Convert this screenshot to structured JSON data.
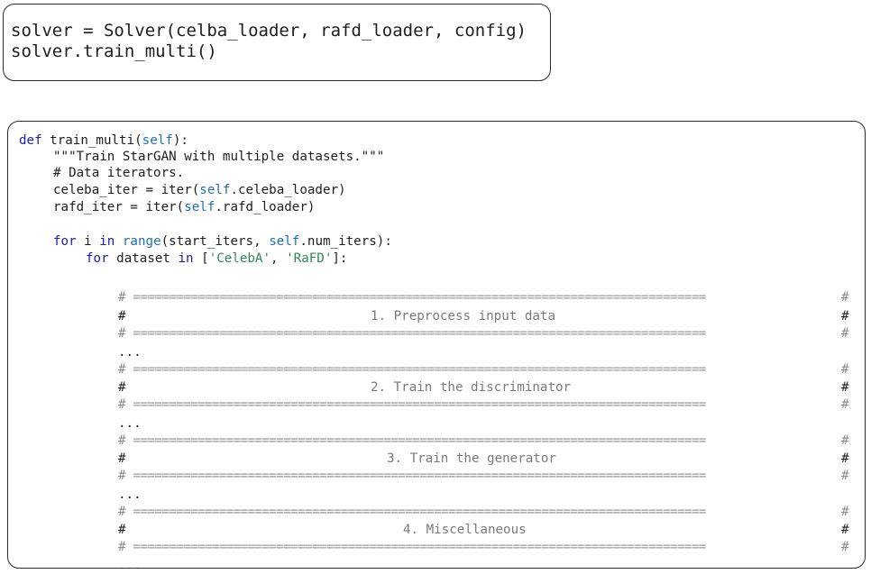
{
  "snippet_top": {
    "line1": "solver = Solver(celba_loader, rafd_loader, config)",
    "line2": "solver.train_multi()"
  },
  "snippet_main": {
    "kw_def": "def",
    "func_name": " train_multi(",
    "self_kw": "self",
    "close_colon": "):",
    "docstring": "\"\"\"Train StarGAN with multiple datasets.\"\"\"",
    "comment_iters": "# Data iterators.",
    "celeba_iter_lhs": "celeba_iter = iter(",
    "celeba_iter_self": "self",
    "celeba_iter_rhs": ".celeba_loader)",
    "rafd_iter_lhs": "rafd_iter = iter(",
    "rafd_iter_self": "self",
    "rafd_iter_rhs": ".rafd_loader)",
    "for_kw": "for",
    "for_i_mid": " i ",
    "in_kw": "in",
    "range_kw": " range",
    "range_args_a": "(start_iters, ",
    "range_self": "self",
    "range_args_b": ".num_iters):",
    "for2_kw": "for",
    "for2_mid": " dataset ",
    "in2_kw": "in",
    "list_open": " [",
    "str_celeba": "'CelebA'",
    "list_comma": ", ",
    "str_rafd": "'RaFD'",
    "list_close": "]:",
    "hash": "#",
    "separator": "================================================================================",
    "ellipsis": "...",
    "sections": [
      "1. Preprocess input data",
      "2. Train the discriminator",
      "3. Train the generator",
      "4. Miscellaneous"
    ]
  }
}
